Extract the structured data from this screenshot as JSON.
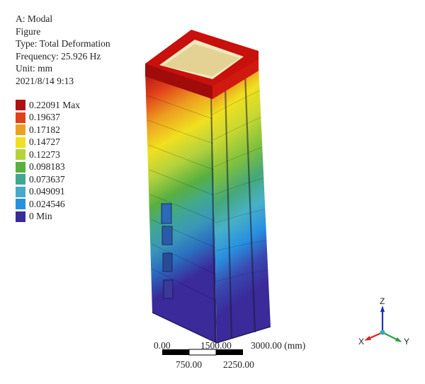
{
  "info": {
    "analysis": "A: Modal",
    "figure": "Figure",
    "type": "Type: Total Deformation",
    "frequency": "Frequency: 25.926 Hz",
    "unit": "Unit: mm",
    "date": "2021/8/14 9:13"
  },
  "legend": {
    "items": [
      {
        "label": "0.22091 Max",
        "color": "#b01010"
      },
      {
        "label": "0.19637",
        "color": "#e0401a"
      },
      {
        "label": "0.17182",
        "color": "#eda020"
      },
      {
        "label": "0.14727",
        "color": "#f0e020"
      },
      {
        "label": "0.12273",
        "color": "#b4d23c"
      },
      {
        "label": "0.098183",
        "color": "#58b040"
      },
      {
        "label": "0.073637",
        "color": "#40a890"
      },
      {
        "label": "0.049091",
        "color": "#4aa8c8"
      },
      {
        "label": "0.024546",
        "color": "#2890e0"
      },
      {
        "label": "0 Min",
        "color": "#3a2a9a"
      }
    ]
  },
  "scale_bar": {
    "top_labels": [
      "0.00",
      "1500.00",
      "3000.00 (mm)"
    ],
    "bottom_labels": [
      "750.00",
      "2250.00"
    ]
  },
  "triad": {
    "x": "X",
    "y": "Y",
    "z": "Z"
  },
  "colors": {
    "x_axis": "#e02020",
    "y_axis": "#30a040",
    "z_axis": "#2030b0",
    "origin": "#30b0b0"
  }
}
